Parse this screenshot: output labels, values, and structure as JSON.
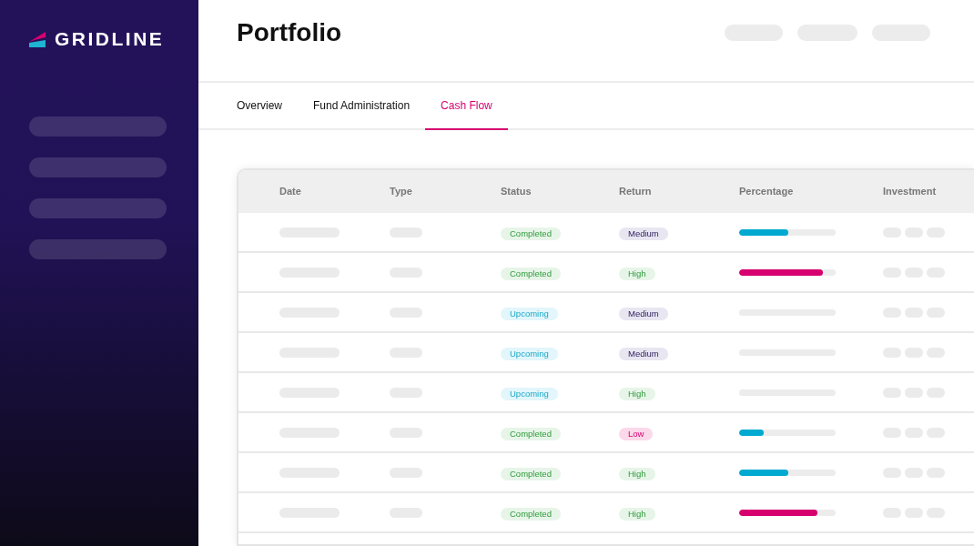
{
  "brand": {
    "name": "GRIDLINE"
  },
  "page": {
    "title": "Portfolio"
  },
  "tabs": [
    {
      "label": "Overview",
      "selected": false
    },
    {
      "label": "Fund Administration",
      "selected": false
    },
    {
      "label": "Cash Flow",
      "selected": true
    }
  ],
  "table": {
    "columns": [
      "Date",
      "Type",
      "Status",
      "Return",
      "Percentage",
      "Investment"
    ],
    "rows": [
      {
        "status": {
          "label": "Completed",
          "kind": "completed"
        },
        "return": {
          "label": "Medium",
          "kind": "medium"
        },
        "percentage": {
          "level": 0.51,
          "color": "#00a9cf"
        }
      },
      {
        "status": {
          "label": "Completed",
          "kind": "completed"
        },
        "return": {
          "label": "High",
          "kind": "high"
        },
        "percentage": {
          "level": 0.87,
          "color": "#d6006f"
        }
      },
      {
        "status": {
          "label": "Upcoming",
          "kind": "upcoming"
        },
        "return": {
          "label": "Medium",
          "kind": "medium"
        }
      },
      {
        "status": {
          "label": "Upcoming",
          "kind": "upcoming"
        },
        "return": {
          "label": "Medium",
          "kind": "medium"
        }
      },
      {
        "status": {
          "label": "Upcoming",
          "kind": "upcoming"
        },
        "return": {
          "label": "High",
          "kind": "high"
        }
      },
      {
        "status": {
          "label": "Completed",
          "kind": "completed"
        },
        "return": {
          "label": "Low",
          "kind": "low"
        },
        "percentage": {
          "level": 0.25,
          "color": "#00a9cf"
        }
      },
      {
        "status": {
          "label": "Completed",
          "kind": "completed"
        },
        "return": {
          "label": "High",
          "kind": "high"
        },
        "percentage": {
          "level": 0.51,
          "color": "#00a9cf"
        }
      },
      {
        "status": {
          "label": "Completed",
          "kind": "completed"
        },
        "return": {
          "label": "High",
          "kind": "high"
        },
        "percentage": {
          "level": 0.81,
          "color": "#d6006f"
        }
      }
    ]
  }
}
